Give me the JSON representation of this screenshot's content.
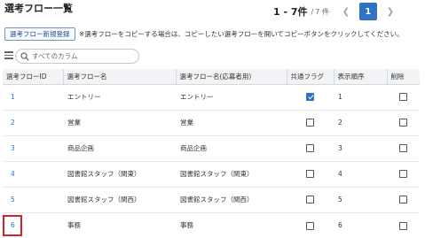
{
  "page": {
    "title": "選考フロー一覧"
  },
  "pagination": {
    "range": "1 - 7件",
    "separator": "/",
    "total": "7 件",
    "current_page": "1",
    "prev_icon": "chevron-left-icon",
    "next_icon": "chevron-right-icon"
  },
  "toolbar": {
    "register_button": "選考フロー新規登録",
    "note": "※選考フローをコピーする場合は、コピーしたい選考フローを開いてコピーボタンをクリックしてください。"
  },
  "search": {
    "placeholder": "すべてのカラム",
    "value": ""
  },
  "table": {
    "columns": [
      "選考フローID",
      "選考フロー名",
      "選考フロー名(応募者用)",
      "共通フラグ",
      "表示順序",
      "削除"
    ],
    "rows": [
      {
        "id": "1",
        "name": "エントリー",
        "applicant_name": "エントリー",
        "common": true,
        "order": "1",
        "delete": false
      },
      {
        "id": "2",
        "name": "営業",
        "applicant_name": "営業",
        "common": false,
        "order": "2",
        "delete": false
      },
      {
        "id": "3",
        "name": "商品企画",
        "applicant_name": "商品企画",
        "common": false,
        "order": "3",
        "delete": false
      },
      {
        "id": "4",
        "name": "図書館スタッフ（関東）",
        "applicant_name": "図書館スタッフ（関東）",
        "common": false,
        "order": "4",
        "delete": false
      },
      {
        "id": "5",
        "name": "図書館スタッフ（関西）",
        "applicant_name": "図書館スタッフ（関西）",
        "common": false,
        "order": "5",
        "delete": false
      },
      {
        "id": "6",
        "name": "事務",
        "applicant_name": "事務",
        "common": false,
        "order": "6",
        "delete": false
      }
    ]
  },
  "colors": {
    "accent": "#2f73c5",
    "highlight": "#d6202a",
    "header_bg": "#f2f3f5"
  }
}
